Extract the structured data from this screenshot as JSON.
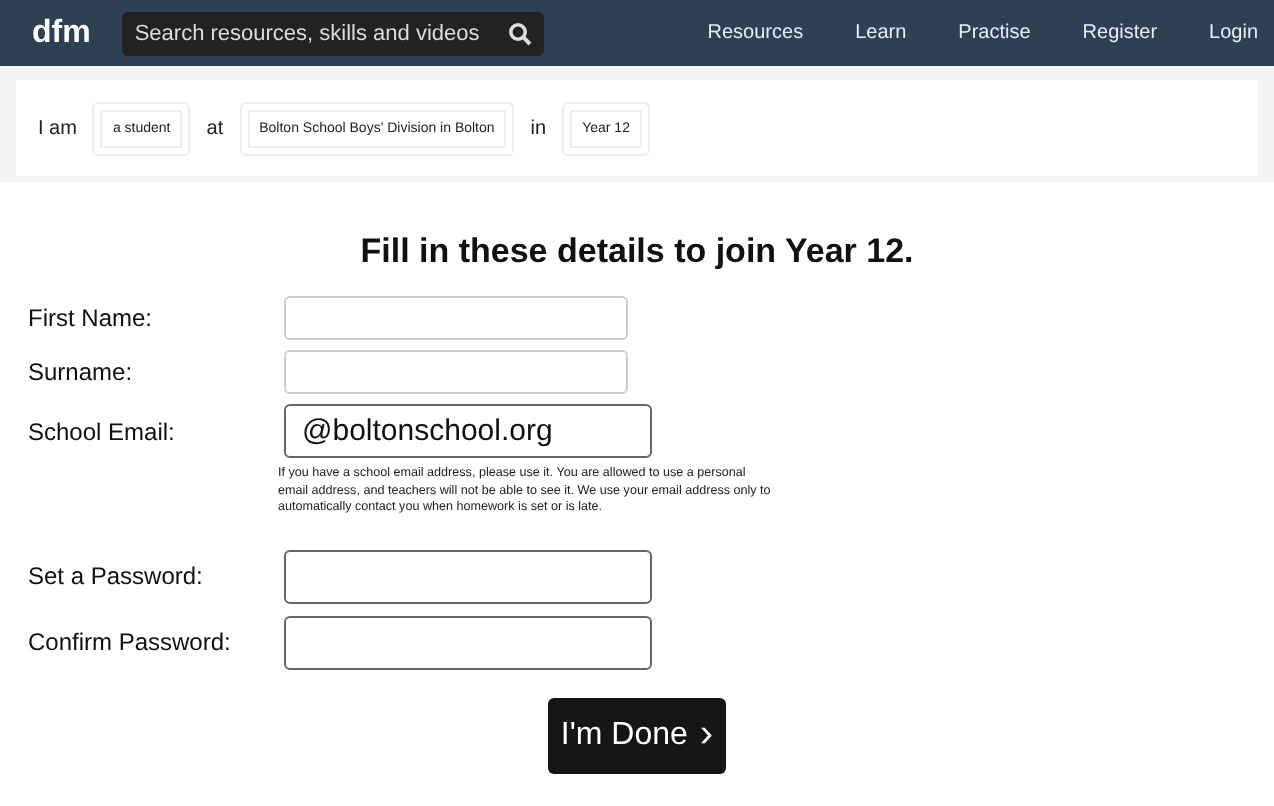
{
  "header": {
    "logo": "dfm",
    "search": {
      "placeholder": "Search resources, skills and videos"
    },
    "nav": [
      "Resources",
      "Learn",
      "Practise",
      "Register",
      "Login"
    ]
  },
  "sentence": [
    {
      "kind": "word",
      "text": "I am"
    },
    {
      "kind": "choice",
      "text": "a student"
    },
    {
      "kind": "word",
      "text": "at"
    },
    {
      "kind": "choice",
      "text": "Bolton School Boys' Division in Bolton"
    },
    {
      "kind": "word",
      "text": "in"
    },
    {
      "kind": "choice",
      "text": "Year 12"
    }
  ],
  "form": {
    "title": "Fill in these details to join Year 12.",
    "fields": [
      {
        "label": "First Name:",
        "kind": "light"
      },
      {
        "label": "Surname:",
        "kind": "light"
      },
      {
        "label": "School Email:",
        "kind": "strong",
        "value": "@boltonschool.org",
        "hint": "If you have a school email address, please use it. You are allowed to use a personal email address, and teachers will not be able to see it. We use your email address only to automatically contact you when homework is set or is late."
      },
      {
        "label": "Set a Password:",
        "kind": "strong"
      },
      {
        "label": "Confirm Password:",
        "kind": "strong"
      }
    ],
    "submit": {
      "label": "I'm Done",
      "icon": "›"
    }
  }
}
